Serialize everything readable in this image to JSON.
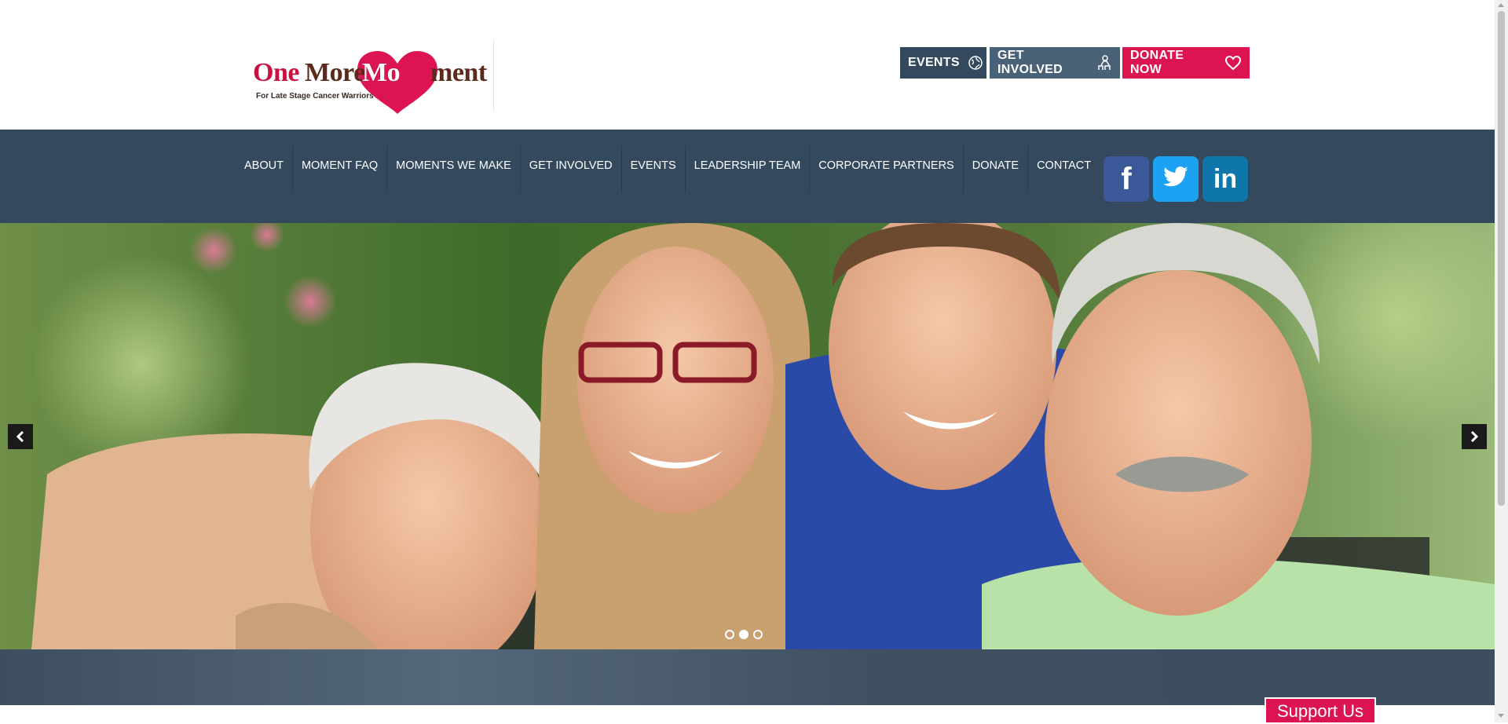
{
  "logo": {
    "word1": "One",
    "word2": "More",
    "word3": "Mo",
    "word4": "ment",
    "tagline": "For Late Stage Cancer Warriors",
    "heart_color": "#dd1452"
  },
  "header_buttons": [
    {
      "label": "EVENTS",
      "icon": "globe-icon"
    },
    {
      "label": "GET INVOLVED",
      "icon": "people-icon"
    },
    {
      "label": "DONATE NOW",
      "icon": "heart-outline-icon"
    }
  ],
  "nav": {
    "items": [
      "ABOUT",
      "MOMENT FAQ",
      "MOMENTS WE MAKE",
      "GET INVOLVED",
      "EVENTS",
      "LEADERSHIP TEAM",
      "CORPORATE PARTNERS",
      "DONATE",
      "CONTACT"
    ]
  },
  "social": {
    "facebook": {
      "glyph": "f",
      "color": "#3b5998"
    },
    "twitter": {
      "icon": "twitter-bird-icon",
      "color": "#1da1f2"
    },
    "linkedin": {
      "glyph": "in",
      "color": "#0e76a8"
    }
  },
  "slider": {
    "slide_count": 3,
    "active_index": 1,
    "description": "Family photo: elderly woman, young woman with red glasses, young man in blue shirt, older man with mustache"
  },
  "support": {
    "label": "Support Us"
  },
  "colors": {
    "primary_dark": "#34495e",
    "accent_pink": "#dd1452"
  }
}
